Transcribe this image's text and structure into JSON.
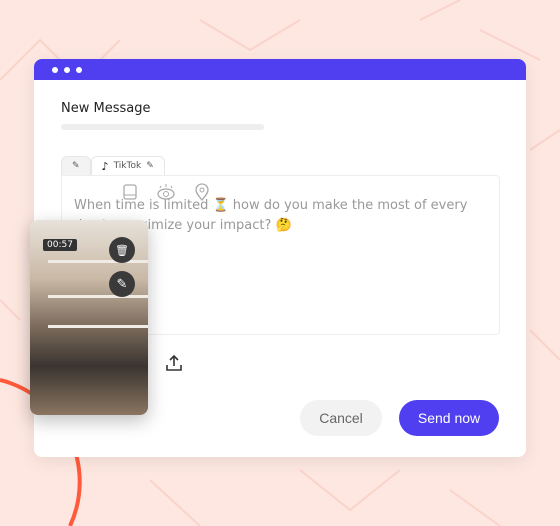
{
  "window": {
    "title": "New Message"
  },
  "tabs": [
    {
      "label": "",
      "icon": "pencil-icon"
    },
    {
      "label": "TikTok",
      "icon": "tiktok-icon"
    }
  ],
  "editor": {
    "text": "When time is limited ⏳ how do you make the most of every day to maximize your impact? 🤔"
  },
  "media": {
    "duration": "00:57"
  },
  "actions": {
    "cancel": "Cancel",
    "send": "Send now"
  },
  "colors": {
    "accent": "#4f3ff0",
    "background": "#fde7e0",
    "arc": "#ff5a3c"
  }
}
